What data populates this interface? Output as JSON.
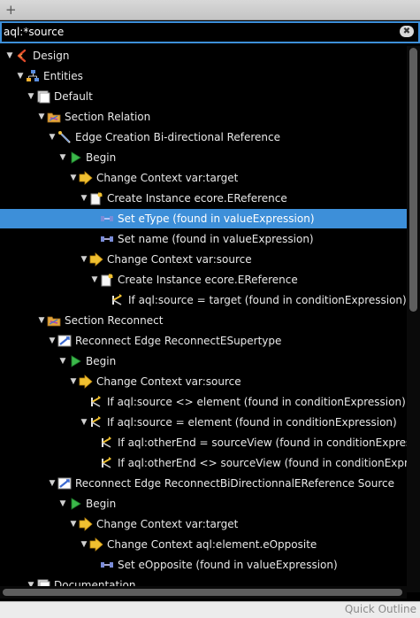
{
  "toolbar": {
    "plus_glyph": "+"
  },
  "search": {
    "value": "aql:*source",
    "clear_glyph": "✖"
  },
  "status": {
    "quick_outline": "Quick Outline"
  },
  "colors": {
    "selection": "#3d8fd9",
    "background": "#000000"
  },
  "tree": [
    {
      "depth": 0,
      "expanded": true,
      "icon": "design-icon",
      "label": "Design"
    },
    {
      "depth": 1,
      "expanded": true,
      "icon": "entities-icon",
      "label": "Entities"
    },
    {
      "depth": 2,
      "expanded": true,
      "icon": "layer-icon",
      "label": "Default"
    },
    {
      "depth": 3,
      "expanded": true,
      "icon": "section-icon",
      "label": "Section Relation"
    },
    {
      "depth": 4,
      "expanded": true,
      "icon": "edge-creation-icon",
      "label": "Edge Creation Bi-directional Reference"
    },
    {
      "depth": 5,
      "expanded": true,
      "icon": "begin-icon",
      "label": "Begin"
    },
    {
      "depth": 6,
      "expanded": true,
      "icon": "change-context-icon",
      "label": "Change Context var:target"
    },
    {
      "depth": 7,
      "expanded": true,
      "icon": "create-instance-icon",
      "label": "Create Instance ecore.EReference"
    },
    {
      "depth": 8,
      "leaf": true,
      "icon": "set-icon",
      "label": "Set eType (found in valueExpression)",
      "selected": true
    },
    {
      "depth": 8,
      "leaf": true,
      "icon": "set-icon",
      "label": "Set name (found in valueExpression)"
    },
    {
      "depth": 7,
      "expanded": true,
      "icon": "change-context-icon",
      "label": "Change Context var:source"
    },
    {
      "depth": 8,
      "expanded": true,
      "icon": "create-instance-icon",
      "label": "Create Instance ecore.EReference"
    },
    {
      "depth": 9,
      "leaf": true,
      "icon": "if-icon",
      "label": "If aql:source = target (found in conditionExpression)"
    },
    {
      "depth": 3,
      "expanded": true,
      "icon": "section-icon",
      "label": "Section Reconnect"
    },
    {
      "depth": 4,
      "expanded": true,
      "icon": "reconnect-edge-icon",
      "label": "Reconnect Edge ReconnectESupertype"
    },
    {
      "depth": 5,
      "expanded": true,
      "icon": "begin-icon",
      "label": "Begin"
    },
    {
      "depth": 6,
      "expanded": true,
      "icon": "change-context-icon",
      "label": "Change Context var:source"
    },
    {
      "depth": 7,
      "leaf": true,
      "icon": "if-icon",
      "label": "If aql:source <> element (found in conditionExpression)"
    },
    {
      "depth": 7,
      "expanded": true,
      "icon": "if-icon",
      "label": "If aql:source = element (found in conditionExpression)"
    },
    {
      "depth": 8,
      "leaf": true,
      "icon": "if-icon",
      "label": "If aql:otherEnd = sourceView (found in conditionExpres"
    },
    {
      "depth": 8,
      "leaf": true,
      "icon": "if-icon",
      "label": "If aql:otherEnd <> sourceView (found in conditionExpre"
    },
    {
      "depth": 4,
      "expanded": true,
      "icon": "reconnect-edge-icon",
      "label": "Reconnect Edge ReconnectBiDirectionnalEReference Source"
    },
    {
      "depth": 5,
      "expanded": true,
      "icon": "begin-icon",
      "label": "Begin"
    },
    {
      "depth": 6,
      "expanded": true,
      "icon": "change-context-icon",
      "label": "Change Context var:target"
    },
    {
      "depth": 7,
      "expanded": true,
      "icon": "change-context-icon",
      "label": "Change Context aql:element.eOpposite"
    },
    {
      "depth": 8,
      "leaf": true,
      "icon": "set-icon",
      "label": "Set eOpposite (found in valueExpression)"
    },
    {
      "depth": 2,
      "expanded": true,
      "icon": "layer-icon",
      "label": "Documentation"
    }
  ]
}
